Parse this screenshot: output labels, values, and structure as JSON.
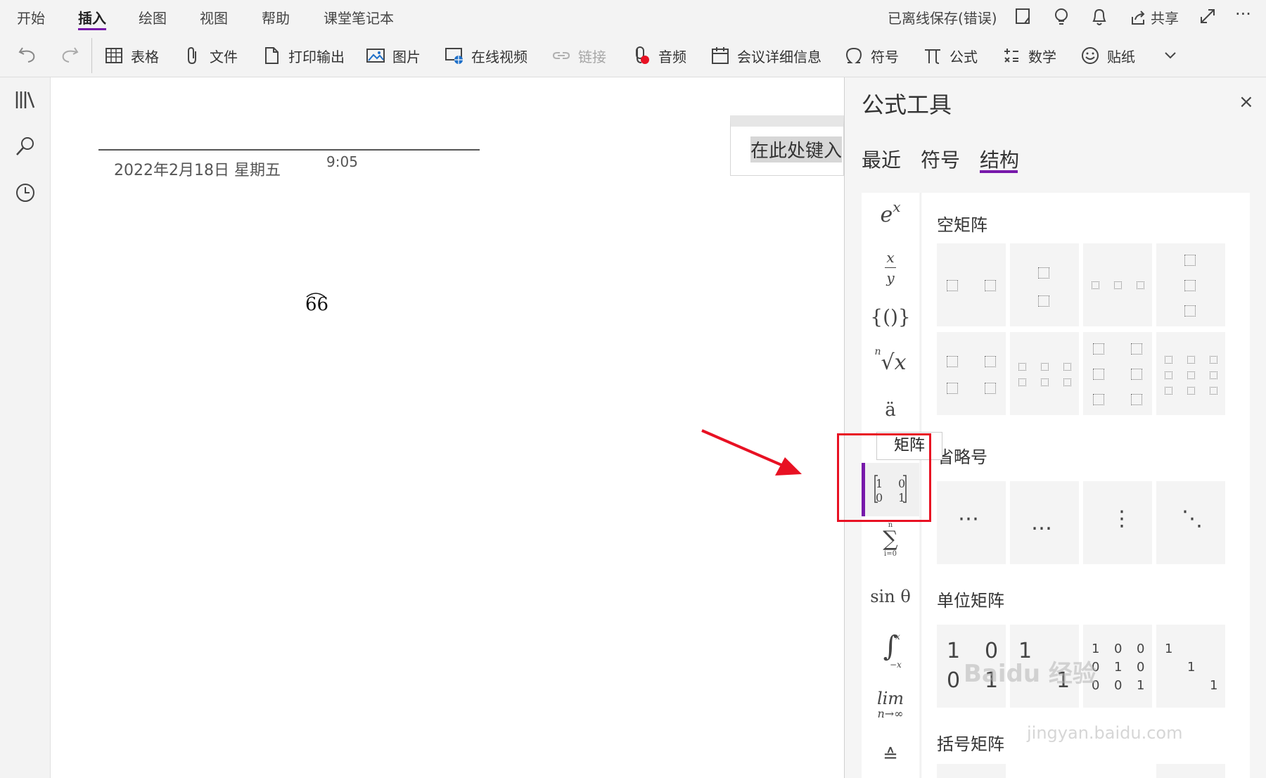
{
  "menu": {
    "tabs": [
      "开始",
      "插入",
      "绘图",
      "视图",
      "帮助",
      "课堂笔记本"
    ],
    "active_tab": "插入",
    "status": "已离线保存(错误)",
    "share": "共享",
    "more": "···"
  },
  "ribbon": {
    "table": "表格",
    "file": "文件",
    "printout": "打印输出",
    "picture": "图片",
    "online_video": "在线视频",
    "link": "链接",
    "audio": "音频",
    "meeting": "会议详细信息",
    "symbol": "符号",
    "equation": "公式",
    "math": "数学",
    "sticker": "贴纸"
  },
  "page": {
    "date": "2022年2月18日 星期五",
    "time": "9:05",
    "equation_text": "66",
    "equation_placeholder": "在此处键入"
  },
  "pane": {
    "title": "公式工具",
    "close": "×",
    "tabs": [
      "最近",
      "符号",
      "结构"
    ],
    "active_tab": "结构",
    "categories": {
      "script": "e",
      "script_sup": "x",
      "frac_num": "x",
      "frac_den": "y",
      "bracket": "{()}",
      "radical_index": "n",
      "radical": "√x",
      "accent": "ä",
      "matrix_tl": "1",
      "matrix_tr": "0",
      "matrix_bl": "0",
      "matrix_br": "1",
      "nary_sub": "i=0",
      "nary_sup": "n",
      "nary": "∑",
      "function": "sin θ",
      "integral": "∫",
      "integral_sup": "x",
      "integral_sub": "−x",
      "limit": "lim",
      "limit_sub": "n→∞",
      "operator": "≙"
    },
    "tooltip": "矩阵",
    "sections": {
      "empty_matrix": "空矩阵",
      "ellipsis": "省略号",
      "identity": "单位矩阵",
      "bracket_matrix": "括号矩阵"
    },
    "ellipsis_glyphs": [
      "⋯",
      "…",
      "⋮",
      "⋱"
    ],
    "identity_values": {
      "two": [
        "1",
        "0",
        "0",
        "1"
      ],
      "two_sparse": [
        "1",
        "1"
      ],
      "three": [
        "1",
        "0",
        "0",
        "0",
        "1",
        "0",
        "0",
        "0",
        "1"
      ],
      "three_sparse": [
        "1",
        "1",
        "1"
      ]
    }
  },
  "watermark": {
    "brand": "Baidu 经验",
    "url": "jingyan.baidu.com"
  },
  "colors": {
    "accent": "#7719aa",
    "highlight": "#e81123"
  }
}
